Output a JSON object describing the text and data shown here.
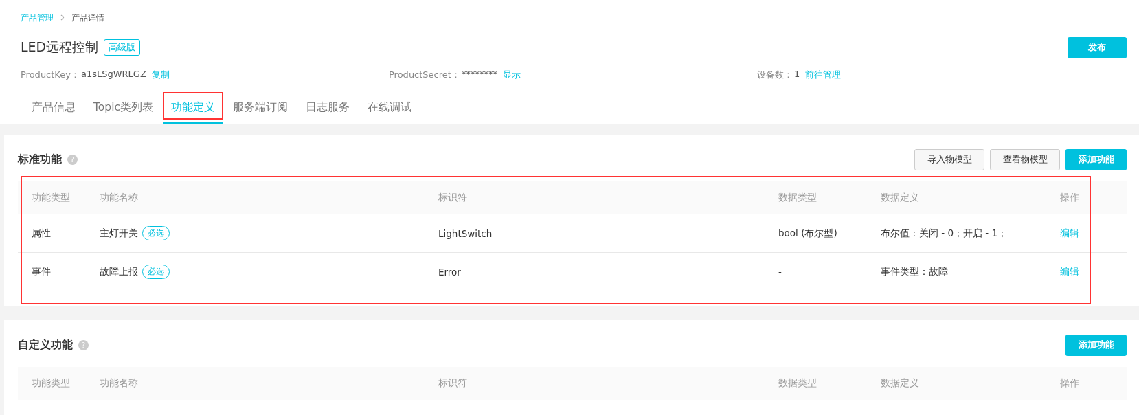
{
  "breadcrumb": [
    {
      "label": "产品管理",
      "link": true
    },
    {
      "label": "产品详情",
      "link": false
    }
  ],
  "product": {
    "name": "LED远程控制",
    "edition": "高级版",
    "publish_button": "发布"
  },
  "info": [
    {
      "label": "ProductKey：",
      "value": "a1sLSgWRLGZ",
      "action": "复制"
    },
    {
      "label": "ProductSecret：",
      "value": "********",
      "action": "显示"
    },
    {
      "label": "设备数：",
      "value": "1",
      "action": "前往管理"
    }
  ],
  "tabs": [
    {
      "label": "产品信息",
      "selected": false,
      "annotated": false
    },
    {
      "label": "Topic类列表",
      "selected": false,
      "annotated": false
    },
    {
      "label": "功能定义",
      "selected": true,
      "annotated": true
    },
    {
      "label": "服务端订阅",
      "selected": false,
      "annotated": false
    },
    {
      "label": "日志服务",
      "selected": false,
      "annotated": false
    },
    {
      "label": "在线调试",
      "selected": false,
      "annotated": false
    }
  ],
  "sections": [
    {
      "title": "标准功能",
      "help_icon": "?",
      "buttons": [
        {
          "label": "导入物模型",
          "kind": "secondary"
        },
        {
          "label": "查看物模型",
          "kind": "secondary"
        },
        {
          "label": "添加功能",
          "kind": "primary"
        }
      ],
      "annotated": true,
      "columns": [
        "功能类型",
        "功能名称",
        "标识符",
        "数据类型",
        "数据定义",
        "操作"
      ],
      "rows": [
        {
          "type": "属性",
          "name": "主灯开关",
          "tag": "必选",
          "identifier": "LightSwitch",
          "data_type": "bool (布尔型)",
          "definition": "布尔值：关闭 - 0；开启 - 1；",
          "action": "编辑"
        },
        {
          "type": "事件",
          "name": "故障上报",
          "tag": "必选",
          "identifier": "Error",
          "data_type": "-",
          "definition": "事件类型：故障",
          "action": "编辑"
        }
      ]
    },
    {
      "title": "自定义功能",
      "help_icon": "?",
      "buttons": [
        {
          "label": "添加功能",
          "kind": "primary"
        }
      ],
      "annotated": false,
      "columns": [
        "功能类型",
        "功能名称",
        "标识符",
        "数据类型",
        "数据定义",
        "操作"
      ]
    }
  ]
}
